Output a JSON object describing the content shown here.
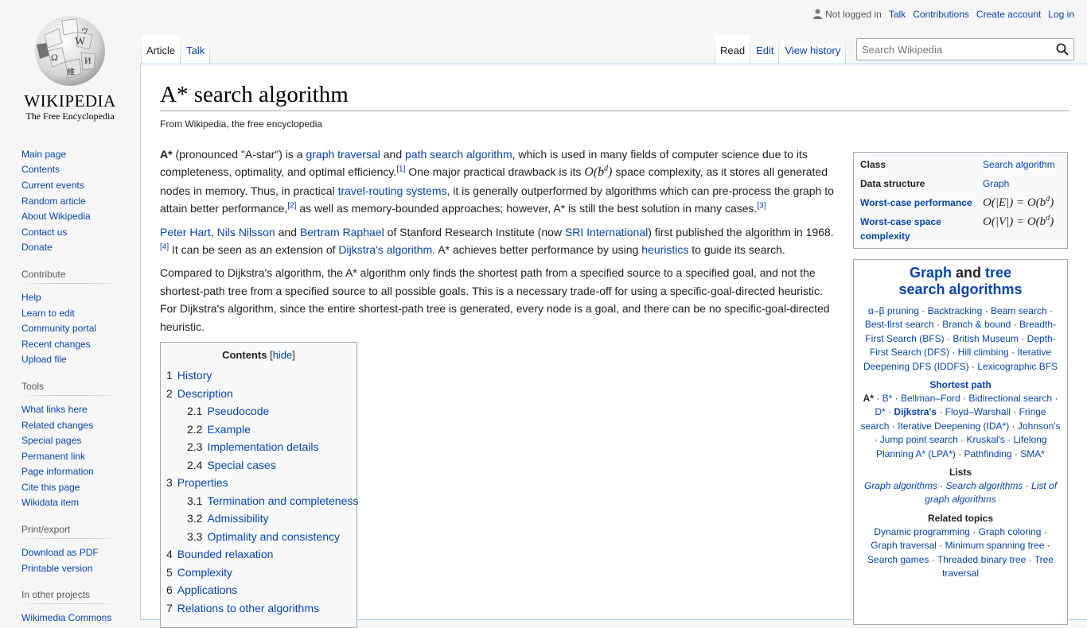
{
  "logo": {
    "wordmark": "WIKIPEDIA",
    "tagline": "The Free Encyclopedia"
  },
  "personal": {
    "status": "Not logged in",
    "links": [
      "Talk",
      "Contributions",
      "Create account",
      "Log in"
    ]
  },
  "tabs": {
    "left": [
      {
        "label": "Article",
        "selected": true
      },
      {
        "label": "Talk",
        "selected": false
      }
    ],
    "right": [
      {
        "label": "Read",
        "selected": true
      },
      {
        "label": "Edit",
        "selected": false
      },
      {
        "label": "View history",
        "selected": false
      }
    ]
  },
  "search": {
    "placeholder": "Search Wikipedia"
  },
  "sidebar": {
    "navigation": [
      "Main page",
      "Contents",
      "Current events",
      "Random article",
      "About Wikipedia",
      "Contact us",
      "Donate"
    ],
    "contribute": {
      "heading": "Contribute",
      "items": [
        "Help",
        "Learn to edit",
        "Community portal",
        "Recent changes",
        "Upload file"
      ]
    },
    "tools": {
      "heading": "Tools",
      "items": [
        "What links here",
        "Related changes",
        "Special pages",
        "Permanent link",
        "Page information",
        "Cite this page",
        "Wikidata item"
      ]
    },
    "print": {
      "heading": "Print/export",
      "items": [
        "Download as PDF",
        "Printable version"
      ]
    },
    "projects": {
      "heading": "In other projects",
      "items": [
        "Wikimedia Commons"
      ]
    }
  },
  "article": {
    "title": "A* search algorithm",
    "sitesub": "From Wikipedia, the free encyclopedia",
    "p1": {
      "term": "A*",
      "t1": " (pronounced \"A-star\") is a ",
      "l1": "graph traversal",
      "t2": " and ",
      "l2": "path search algorithm",
      "t3": ", which is used in many fields of computer science due to its completeness, optimality, and optimal efficiency.",
      "ref1": "[1]",
      "t4": " One major practical drawback is its ",
      "math": "O(b",
      "math_exp": "d",
      "math_end": ")",
      "t5": " space complexity, as it stores all generated nodes in memory. Thus, in practical ",
      "l3": "travel-routing systems",
      "t6": ", it is generally outperformed by algorithms which can pre-process the graph to attain better performance,",
      "ref2": "[2]",
      "t7": " as well as memory-bounded approaches; however, A* is still the best solution in many cases.",
      "ref3": "[3]"
    },
    "p2": {
      "l1": "Peter Hart",
      "t1": ", ",
      "l2": "Nils Nilsson",
      "t2": " and ",
      "l3": "Bertram Raphael",
      "t3": " of Stanford Research Institute (now ",
      "l4": "SRI International",
      "t4": ") first published the algorithm in 1968.",
      "ref4": "[4]",
      "t5": " It can be seen as an extension of ",
      "l5": "Dijkstra's algorithm",
      "t6": ". A* achieves better performance by using ",
      "l6": "heuristics",
      "t7": " to guide its search."
    },
    "p3": "Compared to Dijkstra's algorithm, the A* algorithm only finds the shortest path from a specified source to a specified goal, and not the shortest-path tree from a specified source to all possible goals. This is a necessary trade-off for using a specific-goal-directed heuristic. For Dijkstra's algorithm, since the entire shortest-path tree is generated, every node is a goal, and there can be no specific-goal-directed heuristic."
  },
  "toc": {
    "title": "Contents",
    "toggle": "hide",
    "items": [
      {
        "num": "1",
        "label": "History",
        "level": 1
      },
      {
        "num": "2",
        "label": "Description",
        "level": 1
      },
      {
        "num": "2.1",
        "label": "Pseudocode",
        "level": 2
      },
      {
        "num": "2.2",
        "label": "Example",
        "level": 2
      },
      {
        "num": "2.3",
        "label": "Implementation details",
        "level": 2
      },
      {
        "num": "2.4",
        "label": "Special cases",
        "level": 2
      },
      {
        "num": "3",
        "label": "Properties",
        "level": 1
      },
      {
        "num": "3.1",
        "label": "Termination and completeness",
        "level": 2
      },
      {
        "num": "3.2",
        "label": "Admissibility",
        "level": 2
      },
      {
        "num": "3.3",
        "label": "Optimality and consistency",
        "level": 2
      },
      {
        "num": "4",
        "label": "Bounded relaxation",
        "level": 1
      },
      {
        "num": "5",
        "label": "Complexity",
        "level": 1
      },
      {
        "num": "6",
        "label": "Applications",
        "level": 1
      },
      {
        "num": "7",
        "label": "Relations to other algorithms",
        "level": 1
      }
    ]
  },
  "infobox": {
    "rows": [
      {
        "label": "Class",
        "label_link": false,
        "value": "Search algorithm",
        "value_link": true
      },
      {
        "label": "Data structure",
        "label_link": false,
        "value": "Graph",
        "value_link": true
      },
      {
        "label": "Worst-case performance",
        "label_link": true,
        "value": "O(|E|) = O(b^d)",
        "value_link": false
      },
      {
        "label": "Worst-case space complexity",
        "label_link": true,
        "value": "O(|V|) = O(b^d)",
        "value_link": false
      }
    ]
  },
  "navbox": {
    "title_a": "Graph",
    "title_and": " and ",
    "title_b": "tree",
    "title_c": "search algorithms",
    "general": [
      "α–β pruning",
      "Backtracking",
      "Beam search",
      "Best-first search",
      "Branch & bound",
      "Breadth-First Search (BFS)",
      "British Museum",
      "Depth-First Search (DFS)",
      "Hill climbing",
      "Iterative Deepening DFS (IDDFS)",
      "Lexicographic BFS"
    ],
    "shortest_path": {
      "title": "Shortest path",
      "items": [
        "A*",
        "B*",
        "Bellman–Ford",
        "Bidirectional search",
        "D*",
        "Dijkstra's",
        "Floyd–Warshall",
        "Fringe search",
        "Iterative Deepening (IDA*)",
        "Johnson's",
        "Jump point search",
        "Kruskal's",
        "Lifelong Planning A* (LPA*)",
        "Pathfinding",
        "SMA*"
      ]
    },
    "lists": {
      "title": "Lists",
      "items": [
        "Graph algorithms",
        "Search algorithms",
        "List of graph algorithms"
      ]
    },
    "related": {
      "title": "Related topics",
      "items": [
        "Dynamic programming",
        "Graph coloring",
        "Graph traversal",
        "Minimum spanning tree",
        "Search games",
        "Threaded binary tree",
        "Tree traversal"
      ]
    }
  }
}
